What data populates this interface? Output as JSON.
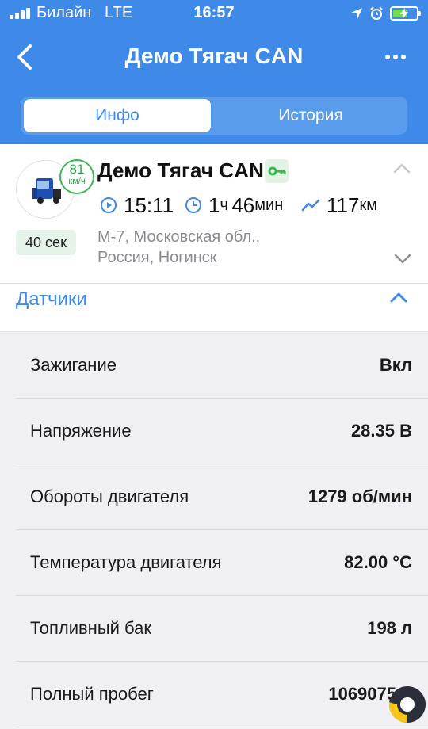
{
  "status_bar": {
    "carrier": "Билайн",
    "network": "LTE",
    "time": "16:57",
    "icons": [
      "location-arrow-icon",
      "alarm-icon",
      "battery-charging-icon"
    ]
  },
  "nav": {
    "title": "Демо Тягач CAN",
    "back_icon": "chevron-left-icon",
    "more_icon": "ellipsis-icon"
  },
  "tabs": [
    {
      "label": "Инфо",
      "active": true
    },
    {
      "label": "История",
      "active": false
    }
  ],
  "vehicle": {
    "name": "Демо Тягач CAN",
    "speed_value": "81",
    "speed_unit": "км/ч",
    "age": "40 сек",
    "start_time": "15:11",
    "duration_hours": "1",
    "duration_hours_unit": "ч",
    "duration_minutes": "46",
    "duration_minutes_unit": "мин",
    "distance_value": "117",
    "distance_unit": "км",
    "address_line1": "М-7, Московская обл.,",
    "address_line2": "Россия, Ногинск"
  },
  "sensors": {
    "title": "Датчики",
    "rows": [
      {
        "label": "Зажигание",
        "value": "Вкл"
      },
      {
        "label": "Напряжение",
        "value": "28.35 В"
      },
      {
        "label": "Обороты двигателя",
        "value": "1279 об/мин"
      },
      {
        "label": "Температура двигателя",
        "value": "82.00 °C"
      },
      {
        "label": "Топливный бак",
        "value": "198 л"
      },
      {
        "label": "Полный пробег",
        "value": "1069075"
      }
    ]
  },
  "colors": {
    "accent": "#3f8ae8",
    "speed_green": "#2da746",
    "badge_bg": "#e6f3e8",
    "key_green": "#3cb553"
  }
}
